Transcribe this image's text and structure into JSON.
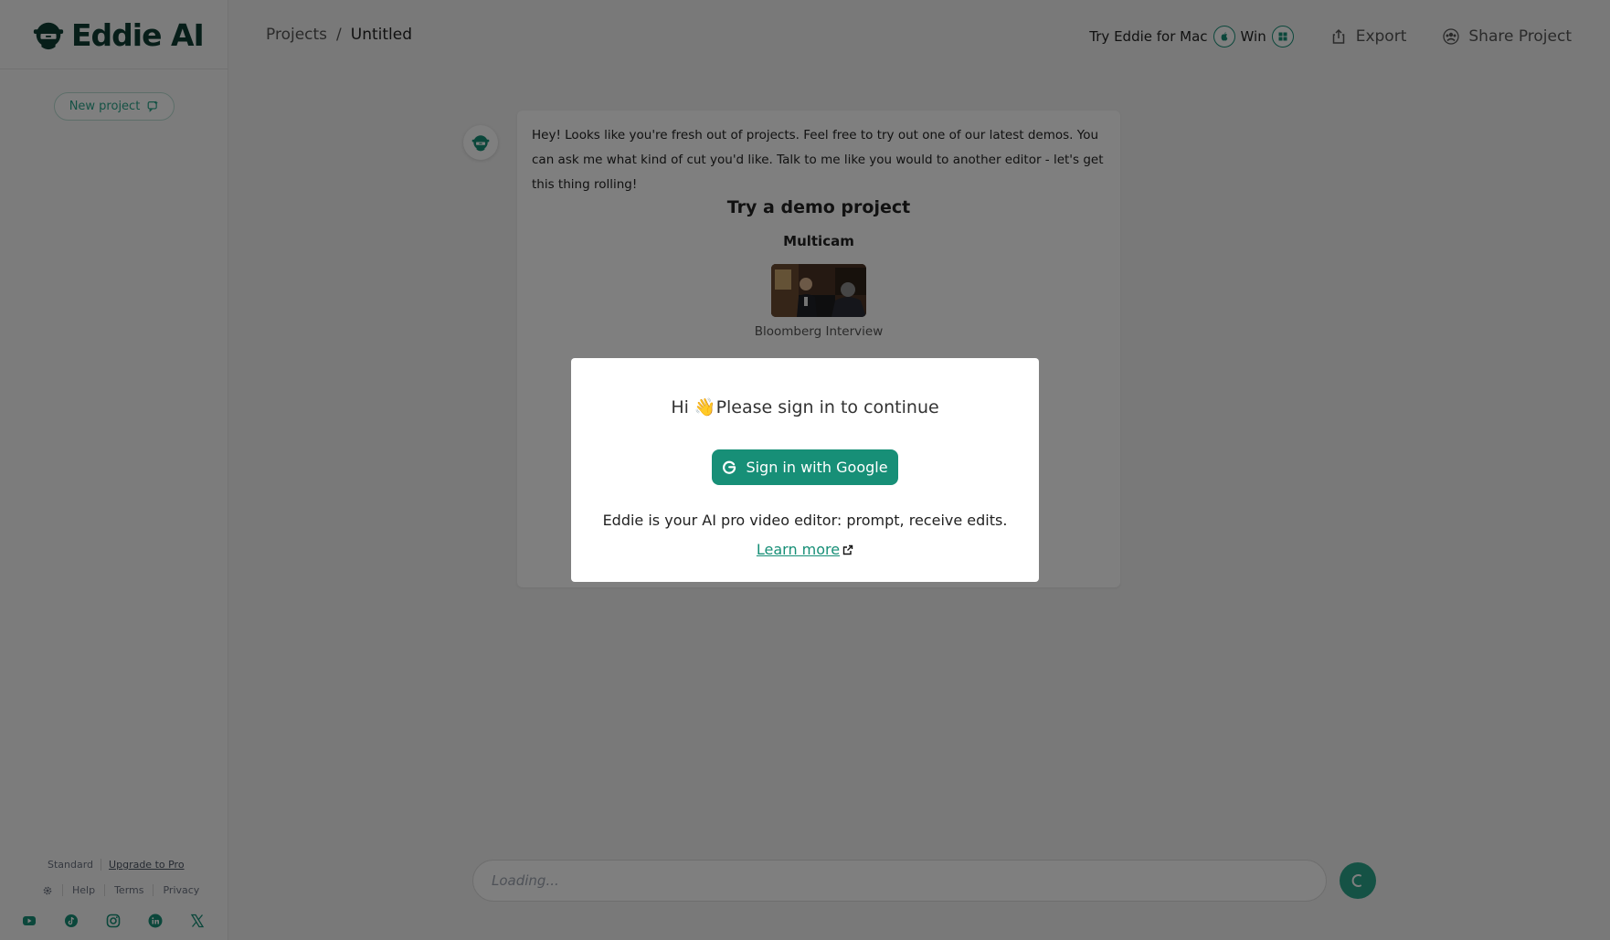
{
  "app": {
    "name": "Eddie AI"
  },
  "sidebar": {
    "new_project_label": "New project",
    "plan_label": "Standard",
    "upgrade_label": "Upgrade to Pro",
    "footer_links": [
      "Help",
      "Terms",
      "Privacy"
    ],
    "social_icons": [
      "youtube-icon",
      "tiktok-icon",
      "instagram-icon",
      "linkedin-icon",
      "x-icon"
    ]
  },
  "header": {
    "breadcrumb_root": "Projects",
    "breadcrumb_separator": "/",
    "breadcrumb_current": "Untitled",
    "try_mac_label": "Try Eddie for Mac",
    "win_label": "Win",
    "export_label": "Export",
    "share_label": "Share Project"
  },
  "chat": {
    "welcome_message": "Hey! Looks like you're fresh out of projects. Feel free to try out one of our latest demos. You can ask me what kind of cut you'd like. Talk to me like you would to another editor - let's get this thing rolling!",
    "demo_title": "Try a demo project",
    "demo_category": "Multicam",
    "demo_caption": "Bloomberg Interview",
    "input_placeholder": "Loading..."
  },
  "modal": {
    "title": "Hi 👋Please sign in to continue",
    "google_button_label": "Sign in with Google",
    "description": "Eddie is your AI pro video editor: prompt, receive edits.",
    "learn_more_label": "Learn more"
  },
  "colors": {
    "brand": "#178f77",
    "brand_light": "#2ba48a",
    "logo_text": "#0f3d33",
    "overlay": "rgba(0,0,0,0.5)"
  }
}
